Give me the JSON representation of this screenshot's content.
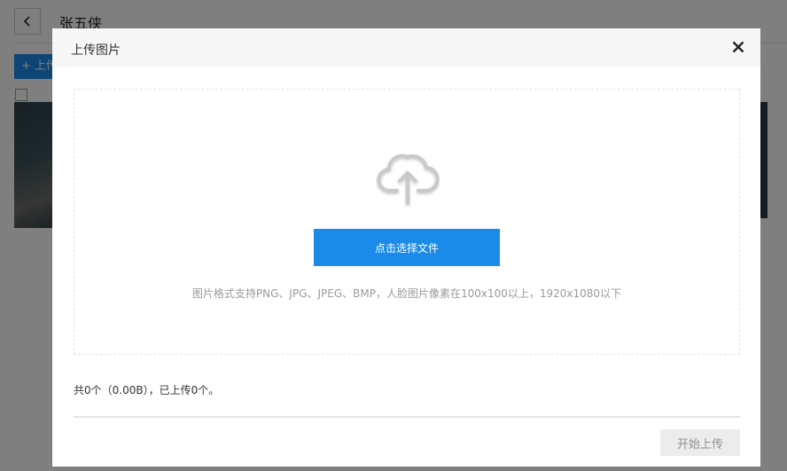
{
  "page": {
    "title": "张五侠",
    "upload_button_label": "+ 上传"
  },
  "modal": {
    "title": "上传图片",
    "choose_file_label": "点击选择文件",
    "hint": "图片格式支持PNG、JPG、JPEG、BMP，人脸图片像素在100x100以上，1920x1080以下",
    "summary": "共0个（0.00B），已上传0个。",
    "start_upload_label": "开始上传"
  },
  "icons": {
    "back": "chevron-left-icon",
    "close": "close-icon",
    "upload": "cloud-upload-icon"
  },
  "colors": {
    "primary": "#1a8be8",
    "overlay": "rgba(0,0,0,0.5)",
    "disabled_button_bg": "#ececec"
  }
}
